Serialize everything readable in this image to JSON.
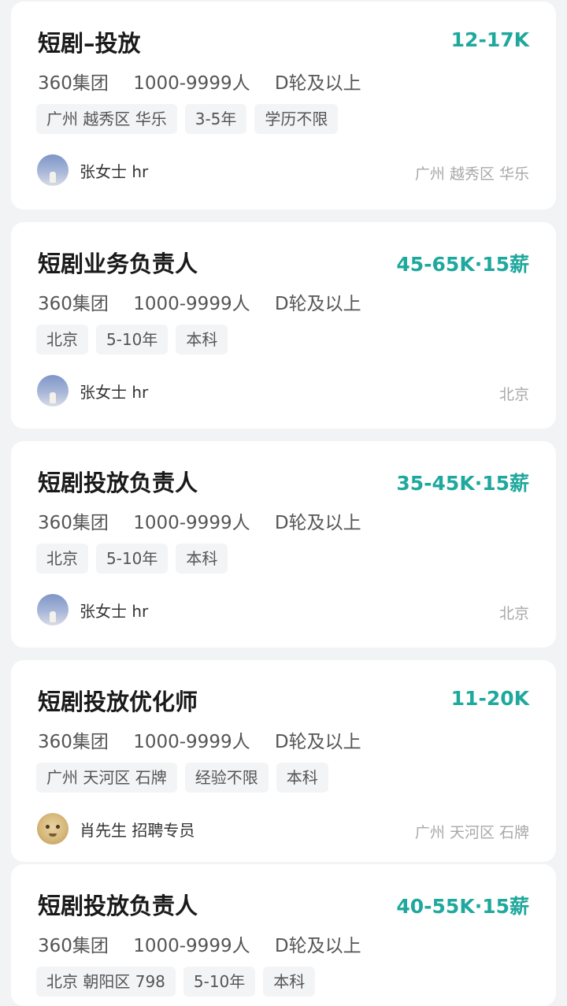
{
  "jobs": [
    {
      "title": "短剧–投放",
      "salary": "12-17K",
      "company": "360集团",
      "size": "1000-9999人",
      "stage": "D轮及以上",
      "tags": [
        "广州 越秀区 华乐",
        "3-5年",
        "学历不限"
      ],
      "recruiter": "张女士 hr",
      "location": "广州 越秀区 华乐"
    },
    {
      "title": "短剧业务负责人",
      "salary": "45-65K·15薪",
      "company": "360集团",
      "size": "1000-9999人",
      "stage": "D轮及以上",
      "tags": [
        "北京",
        "5-10年",
        "本科"
      ],
      "recruiter": "张女士 hr",
      "location": "北京"
    },
    {
      "title": "短剧投放负责人",
      "salary": "35-45K·15薪",
      "company": "360集团",
      "size": "1000-9999人",
      "stage": "D轮及以上",
      "tags": [
        "北京",
        "5-10年",
        "本科"
      ],
      "recruiter": "张女士 hr",
      "location": "北京"
    },
    {
      "title": "短剧投放优化师",
      "salary": "11-20K",
      "company": "360集团",
      "size": "1000-9999人",
      "stage": "D轮及以上",
      "tags": [
        "广州 天河区 石牌",
        "经验不限",
        "本科"
      ],
      "recruiter": "肖先生 招聘专员",
      "location": "广州 天河区 石牌"
    },
    {
      "title": "短剧投放负责人",
      "salary": "40-55K·15薪",
      "company": "360集团",
      "size": "1000-9999人",
      "stage": "D轮及以上",
      "tags": [
        "北京 朝阳区 798",
        "5-10年",
        "本科"
      ]
    }
  ],
  "colors": {
    "salary": "#1fa89d",
    "background": "#f2f3f5",
    "card": "#ffffff",
    "tag_bg": "#f3f4f6"
  },
  "icons": {
    "avatar_1": "avatar-sky",
    "avatar_2": "avatar-sky",
    "avatar_3": "avatar-sky",
    "avatar_4": "avatar-face"
  }
}
